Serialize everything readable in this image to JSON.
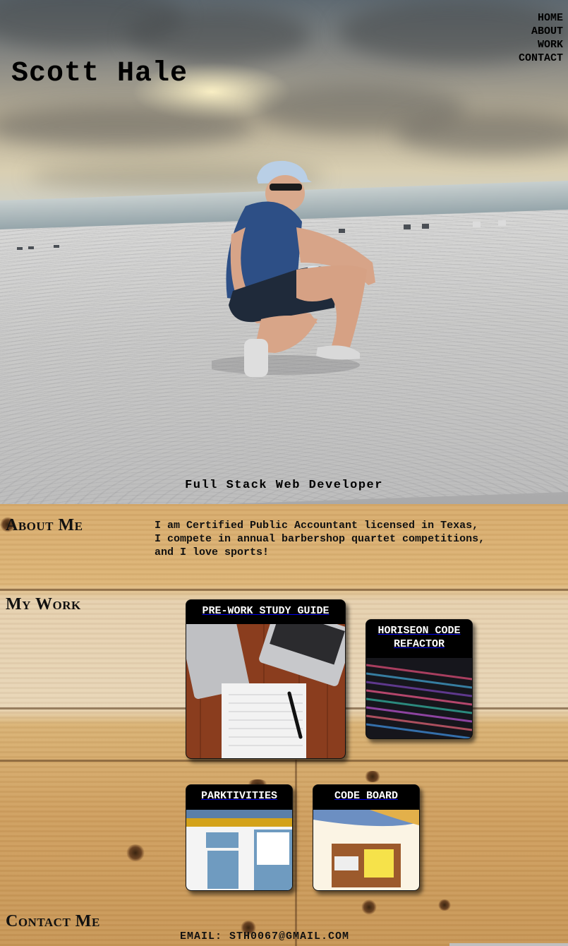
{
  "header": {
    "title": "Scott Hale",
    "tagline": "Full Stack Web Developer"
  },
  "nav": {
    "items": [
      "HOME",
      "ABOUT",
      "WORK",
      "CONTACT"
    ]
  },
  "about": {
    "heading": "About Me",
    "text": "I am Certified Public Accountant licensed in Texas, I compete in annual barbershop quartet competitions, and I love sports!"
  },
  "work": {
    "heading": "My Work",
    "projects": [
      {
        "title": "PRE-WORK STUDY GUIDE"
      },
      {
        "title": "HORISEON CODE REFACTOR"
      },
      {
        "title": "PARKTIVITIES"
      },
      {
        "title": "CODE BOARD"
      }
    ]
  },
  "contact": {
    "heading": "Contact Me",
    "email": "EMAIL: STH0067@GMAIL.COM"
  }
}
